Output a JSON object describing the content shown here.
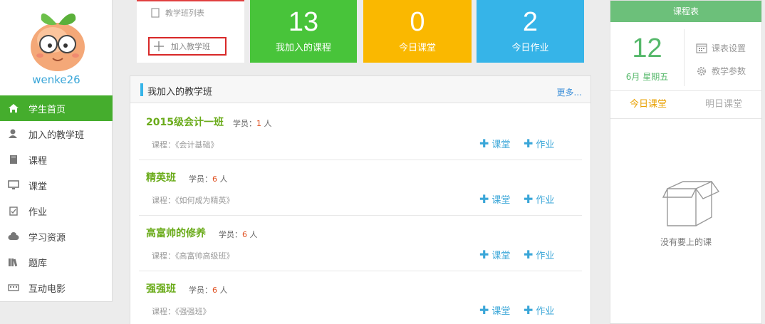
{
  "user": {
    "name": "wenke26"
  },
  "nav": [
    {
      "label": "学生首页",
      "icon": "home-icon",
      "active": true
    },
    {
      "label": "加入的教学班",
      "icon": "user-icon"
    },
    {
      "label": "课程",
      "icon": "book-icon"
    },
    {
      "label": "课堂",
      "icon": "monitor-icon"
    },
    {
      "label": "作业",
      "icon": "clipboard-icon"
    },
    {
      "label": "学习资源",
      "icon": "cloud-icon"
    },
    {
      "label": "题库",
      "icon": "library-icon"
    },
    {
      "label": "互动电影",
      "icon": "film-icon"
    }
  ],
  "menu": {
    "list_label": "教学班列表",
    "add_label": "加入教学班"
  },
  "tiles": [
    {
      "value": "13",
      "label": "我加入的课程",
      "color": "#48c43a"
    },
    {
      "value": "0",
      "label": "今日课堂",
      "color": "#fab800"
    },
    {
      "value": "2",
      "label": "今日作业",
      "color": "#36b4e8"
    }
  ],
  "panel": {
    "title": "我加入的教学班",
    "more": "更多...",
    "classes": [
      {
        "name": "2015级会计一班",
        "members_label": "学员：",
        "count": "1",
        "unit": " 人",
        "course": "课程：《会计基础》"
      },
      {
        "name": "精英班",
        "members_label": "学员：",
        "count": "6",
        "unit": " 人",
        "course": "课程：《如何成为精英》"
      },
      {
        "name": "高富帅的修养",
        "members_label": "学员：",
        "count": "6",
        "unit": " 人",
        "course": "课程：《高富帅高级班》"
      },
      {
        "name": "强强班",
        "members_label": "学员：",
        "count": "6",
        "unit": " 人",
        "course": "课程：《强强班》"
      }
    ],
    "action_class": "课堂",
    "action_homework": "作业"
  },
  "schedule": {
    "title": "课程表",
    "day": "12",
    "month_week": "6月 星期五",
    "settings": "课表设置",
    "params": "教学参数",
    "tab_today": "今日课堂",
    "tab_tomorrow": "明日课堂",
    "empty": "没有要上的课"
  },
  "colors": {
    "accent_green": "#45ad2d",
    "link_blue": "#3aa6d8",
    "class_green": "#6aab1a"
  }
}
